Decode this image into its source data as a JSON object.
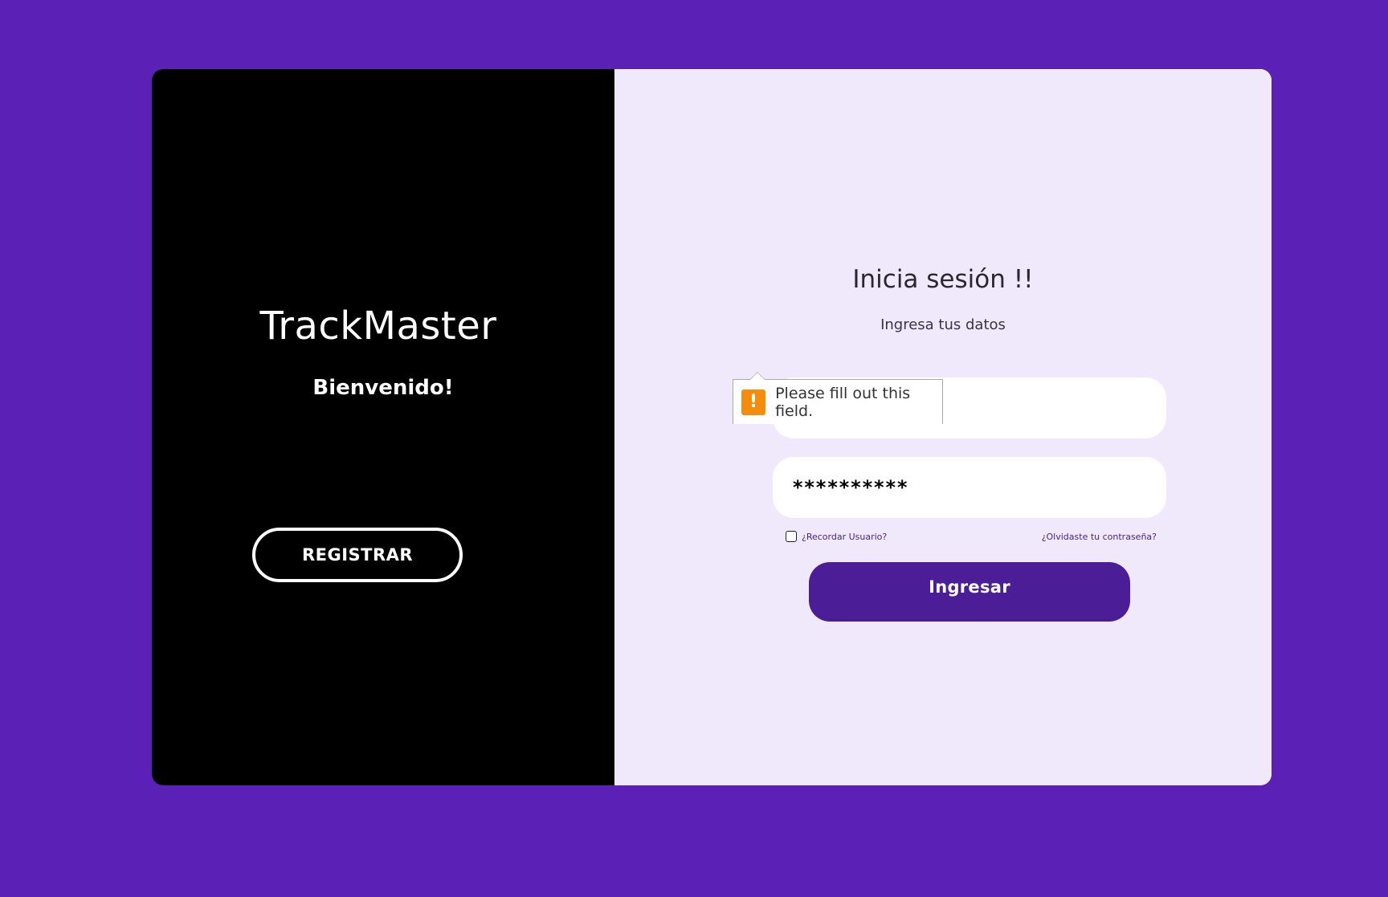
{
  "left_panel": {
    "brand": "TrackMaster",
    "welcome": "Bienvenido!",
    "register_label": "REGISTRAR"
  },
  "login": {
    "title": "Inicia sesión !!",
    "subtitle": "Ingresa tus datos",
    "username_value": "",
    "password_value": "**********",
    "remember_label": "¿Recordar Usuario?",
    "forgot_label": "¿Olvidaste tu contraseña?",
    "submit_label": "Ingresar"
  },
  "validation": {
    "message": "Please fill out this field.",
    "icon": "!"
  },
  "colors": {
    "background": "#5b20b6",
    "left_panel": "#000000",
    "right_panel": "#f0e9fc",
    "primary_button": "#4b1d96",
    "warning": "#f58c0c"
  }
}
